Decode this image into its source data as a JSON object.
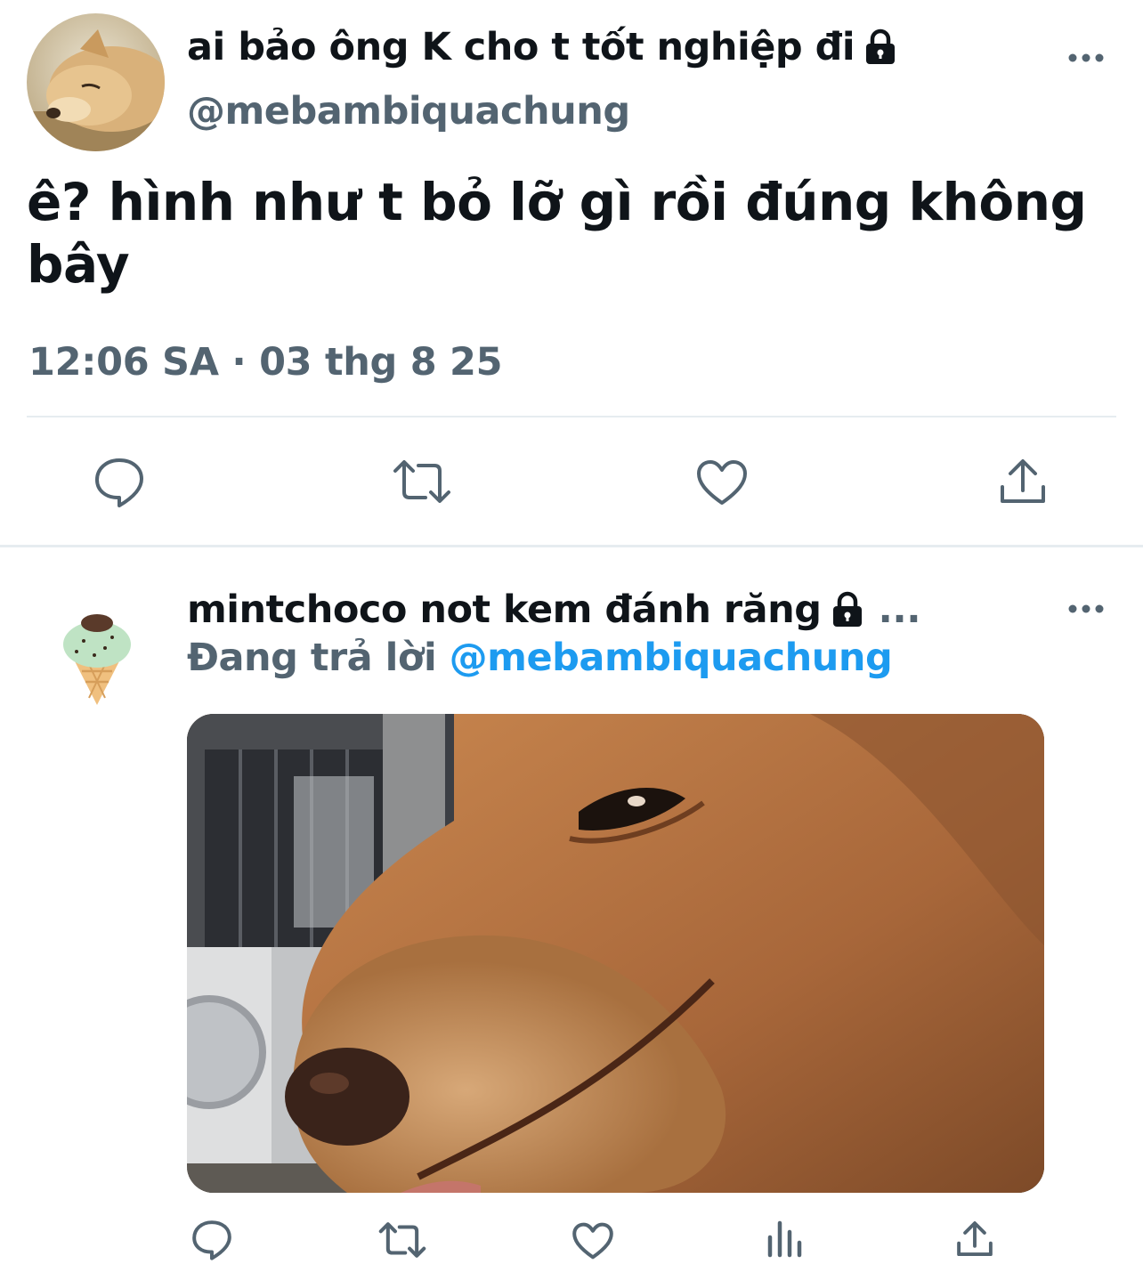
{
  "main_tweet": {
    "display_name": "ai bảo ông K cho t tốt nghiệp đi",
    "handle": "@mebambiquachung",
    "text": "ê? hình như t bỏ lỡ gì rồi đúng không bây",
    "timestamp": "12:06 SA · 03 thg 8 25",
    "locked": true,
    "actions": [
      "reply-icon",
      "retweet-icon",
      "like-icon",
      "share-icon"
    ]
  },
  "reply_tweet": {
    "display_name": "mintchoco not kem đánh răng",
    "name_overflow": "...",
    "replying_prefix": "Đang trả lời",
    "replying_to": "@mebambiquachung",
    "locked": true,
    "media": "photo of a golden retriever smiling up close",
    "actions": [
      "reply-icon",
      "retweet-icon",
      "like-icon",
      "analytics-icon",
      "share-icon"
    ]
  },
  "colors": {
    "text_primary": "#0f1419",
    "text_secondary": "#536471",
    "accent": "#1d9bf0",
    "divider": "#e6ecf0"
  }
}
